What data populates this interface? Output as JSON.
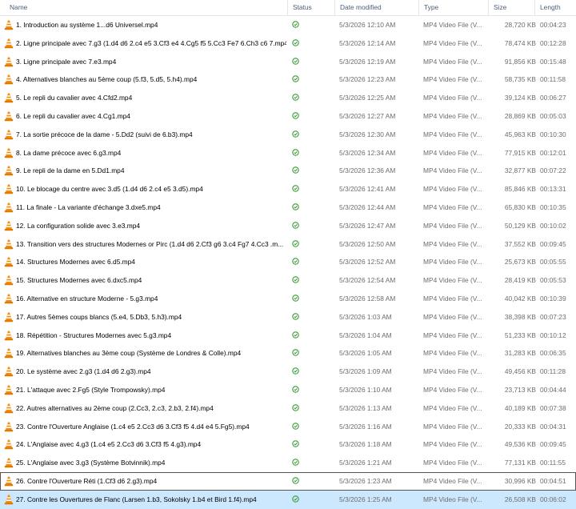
{
  "header": {
    "name": "Name",
    "status": "Status",
    "date": "Date modified",
    "type": "Type",
    "size": "Size",
    "length": "Length"
  },
  "colors": {
    "vlc_orange": "#f28c0f",
    "status_green": "#3a9a3a",
    "selected_row": "#cce8ff"
  },
  "icons": {
    "file": "vlc-cone-icon",
    "status": "sync-check-icon",
    "sort": "sort-ascending-icon"
  },
  "files": [
    {
      "name": "1. Introduction au système 1...d6 Universel.mp4",
      "date": "5/3/2026 12:10 AM",
      "type": "MP4 Video File (V...",
      "size": "28,720 KB",
      "length": "00:04:23"
    },
    {
      "name": "2. Ligne principale avec 7.g3 (1.d4 d6 2.c4 e5 3.Cf3 e4 4.Cg5 f5 5.Cc3 Fe7 6.Ch3 c6 7.mp4",
      "date": "5/3/2026 12:14 AM",
      "type": "MP4 Video File (V...",
      "size": "78,474 KB",
      "length": "00:12:28"
    },
    {
      "name": "3. Ligne principale avec 7.e3.mp4",
      "date": "5/3/2026 12:19 AM",
      "type": "MP4 Video File (V...",
      "size": "91,856 KB",
      "length": "00:15:48"
    },
    {
      "name": "4. Alternatives blanches au 5ème coup (5.f3, 5.d5, 5.h4).mp4",
      "date": "5/3/2026 12:23 AM",
      "type": "MP4 Video File (V...",
      "size": "58,735 KB",
      "length": "00:11:58"
    },
    {
      "name": "5. Le repli du cavalier avec 4.Cfd2.mp4",
      "date": "5/3/2026 12:25 AM",
      "type": "MP4 Video File (V...",
      "size": "39,124 KB",
      "length": "00:06:27"
    },
    {
      "name": "6. Le repli du cavalier avec 4.Cg1.mp4",
      "date": "5/3/2026 12:27 AM",
      "type": "MP4 Video File (V...",
      "size": "28,869 KB",
      "length": "00:05:03"
    },
    {
      "name": "7. La sortie précoce de la dame - 5.Dd2 (suivi de 6.b3).mp4",
      "date": "5/3/2026 12:30 AM",
      "type": "MP4 Video File (V...",
      "size": "45,963 KB",
      "length": "00:10:30"
    },
    {
      "name": "8. La dame précoce avec 6.g3.mp4",
      "date": "5/3/2026 12:34 AM",
      "type": "MP4 Video File (V...",
      "size": "77,915 KB",
      "length": "00:12:01"
    },
    {
      "name": "9. Le repli de la dame en 5.Dd1.mp4",
      "date": "5/3/2026 12:36 AM",
      "type": "MP4 Video File (V...",
      "size": "32,877 KB",
      "length": "00:07:22"
    },
    {
      "name": "10. Le blocage du centre avec 3.d5 (1.d4 d6 2.c4 e5 3.d5).mp4",
      "date": "5/3/2026 12:41 AM",
      "type": "MP4 Video File (V...",
      "size": "85,846 KB",
      "length": "00:13:31"
    },
    {
      "name": "11. La finale - La variante d'échange 3.dxe5.mp4",
      "date": "5/3/2026 12:44 AM",
      "type": "MP4 Video File (V...",
      "size": "65,830 KB",
      "length": "00:10:35"
    },
    {
      "name": "12. La configuration solide avec 3.e3.mp4",
      "date": "5/3/2026 12:47 AM",
      "type": "MP4 Video File (V...",
      "size": "50,129 KB",
      "length": "00:10:02"
    },
    {
      "name": "13. Transition vers des structures Modernes or Pirc (1.d4 d6 2.Cf3 g6 3.c4 Fg7 4.Cc3 .m...",
      "date": "5/3/2026 12:50 AM",
      "type": "MP4 Video File (V...",
      "size": "37,552 KB",
      "length": "00:09:45"
    },
    {
      "name": "14. Structures Modernes avec 6.d5.mp4",
      "date": "5/3/2026 12:52 AM",
      "type": "MP4 Video File (V...",
      "size": "25,673 KB",
      "length": "00:05:55"
    },
    {
      "name": "15. Structures Modernes avec 6.dxc5.mp4",
      "date": "5/3/2026 12:54 AM",
      "type": "MP4 Video File (V...",
      "size": "28,419 KB",
      "length": "00:05:53"
    },
    {
      "name": "16. Alternative en structure Moderne - 5.g3.mp4",
      "date": "5/3/2026 12:58 AM",
      "type": "MP4 Video File (V...",
      "size": "40,042 KB",
      "length": "00:10:39"
    },
    {
      "name": "17. Autres 5èmes coups blancs (5.e4, 5.Db3, 5.h3).mp4",
      "date": "5/3/2026 1:03 AM",
      "type": "MP4 Video File (V...",
      "size": "38,398 KB",
      "length": "00:07:23"
    },
    {
      "name": "18. Répétition - Structures Modernes avec 5.g3.mp4",
      "date": "5/3/2026 1:04 AM",
      "type": "MP4 Video File (V...",
      "size": "51,233 KB",
      "length": "00:10:12"
    },
    {
      "name": "19. Alternatives blanches au 3ème coup (Système de Londres & Colle).mp4",
      "date": "5/3/2026 1:05 AM",
      "type": "MP4 Video File (V...",
      "size": "31,283 KB",
      "length": "00:06:35"
    },
    {
      "name": "20. Le système avec 2.g3 (1.d4 d6 2.g3).mp4",
      "date": "5/3/2026 1:09 AM",
      "type": "MP4 Video File (V...",
      "size": "49,456 KB",
      "length": "00:11:28"
    },
    {
      "name": "21. L'attaque avec 2.Fg5 (Style Trompowsky).mp4",
      "date": "5/3/2026 1:10 AM",
      "type": "MP4 Video File (V...",
      "size": "23,713 KB",
      "length": "00:04:44"
    },
    {
      "name": "22. Autres alternatives au 2ème coup (2.Cc3, 2.c3, 2.b3, 2.f4).mp4",
      "date": "5/3/2026 1:13 AM",
      "type": "MP4 Video File (V...",
      "size": "40,189 KB",
      "length": "00:07:38"
    },
    {
      "name": "23. Contre l'Ouverture Anglaise (1.c4 e5 2.Cc3 d6 3.Cf3 f5 4.d4 e4 5.Fg5).mp4",
      "date": "5/3/2026 1:16 AM",
      "type": "MP4 Video File (V...",
      "size": "20,333 KB",
      "length": "00:04:31"
    },
    {
      "name": "24. L'Anglaise avec 4.g3 (1.c4 e5 2.Cc3 d6 3.Cf3 f5 4.g3).mp4",
      "date": "5/3/2026 1:18 AM",
      "type": "MP4 Video File (V...",
      "size": "49,536 KB",
      "length": "00:09:45"
    },
    {
      "name": "25. L'Anglaise avec 3.g3 (Système Botvinnik).mp4",
      "date": "5/3/2026 1:21 AM",
      "type": "MP4 Video File (V...",
      "size": "77,131 KB",
      "length": "00:11:55"
    },
    {
      "name": "26. Contre l'Ouverture Réti (1.Cf3 d6 2.g3).mp4",
      "date": "5/3/2026 1:23 AM",
      "type": "MP4 Video File (V...",
      "size": "30,996 KB",
      "length": "00:04:51"
    },
    {
      "name": "27. Contre les Ouvertures de Flanc (Larsen 1.b3, Sokolsky 1.b4 et Bird 1.f4).mp4",
      "date": "5/3/2026 1:25 AM",
      "type": "MP4 Video File (V...",
      "size": "26,508 KB",
      "length": "00:06:02"
    }
  ]
}
